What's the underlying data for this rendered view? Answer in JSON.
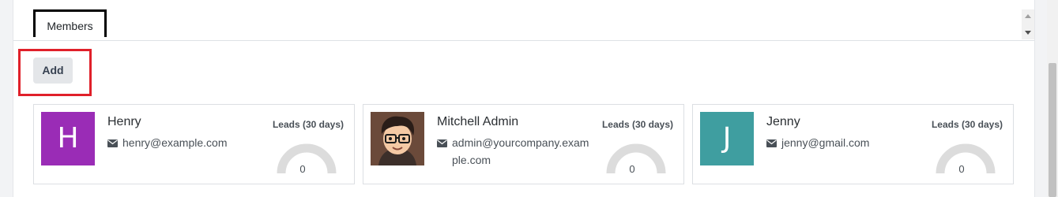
{
  "tabs": {
    "members_label": "Members"
  },
  "actions": {
    "add_label": "Add"
  },
  "members": [
    {
      "name": "Henry",
      "email": "henry@example.com",
      "avatar_initial": "H",
      "avatar_color": "#9a2cb6",
      "leads_label": "Leads (30 days)",
      "leads_value": "0"
    },
    {
      "name": "Mitchell Admin",
      "email": "admin@yourcompany.example.com",
      "email_line1": "admin@yourcompany.exam",
      "email_line2": "ple.com",
      "avatar_color": "#6b4a3a",
      "leads_label": "Leads (30 days)",
      "leads_value": "0"
    },
    {
      "name": "Jenny",
      "email": "jenny@gmail.com",
      "avatar_initial": "J",
      "avatar_color": "#3f9ea0",
      "leads_label": "Leads (30 days)",
      "leads_value": "0"
    }
  ],
  "colors": {
    "highlight_tab": "#000000",
    "highlight_add": "#e0202a",
    "gauge": "#dcdcdc"
  }
}
